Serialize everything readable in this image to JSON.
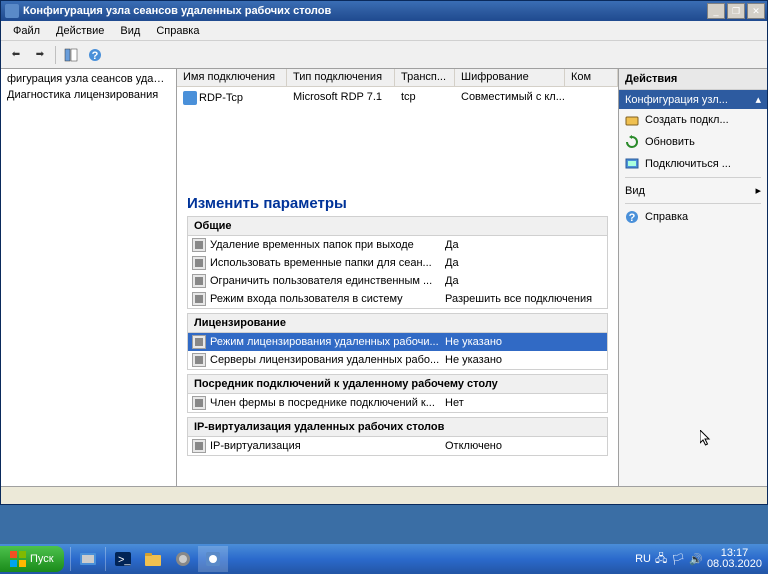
{
  "window": {
    "title": "Конфигурация узла сеансов удаленных рабочих столов"
  },
  "menu": {
    "file": "Файл",
    "action": "Действие",
    "view": "Вид",
    "help": "Справка"
  },
  "tree": {
    "item1": "фигурация узла сеансов удаленны",
    "item2": "Диагностика лицензирования"
  },
  "connections": {
    "headers": {
      "name": "Имя подключения",
      "type": "Тип подключения",
      "transport": "Трансп...",
      "encryption": "Шифрование",
      "com": "Ком"
    },
    "row": {
      "name": "RDP-Tcp",
      "type": "Microsoft RDP 7.1",
      "transport": "tcp",
      "encryption": "Совместимый с кл..."
    }
  },
  "settings": {
    "title": "Изменить параметры",
    "sections": {
      "general": {
        "header": "Общие",
        "items": [
          {
            "label": "Удаление временных папок при выходе",
            "value": "Да"
          },
          {
            "label": "Использовать временные папки для сеан...",
            "value": "Да"
          },
          {
            "label": "Ограничить пользователя единственным ...",
            "value": "Да"
          },
          {
            "label": "Режим входа пользователя в систему",
            "value": "Разрешить все подключения"
          }
        ]
      },
      "licensing": {
        "header": "Лицензирование",
        "items": [
          {
            "label": "Режим лицензирования удаленных рабочи...",
            "value": "Не указано"
          },
          {
            "label": "Серверы лицензирования удаленных рабо...",
            "value": "Не указано"
          }
        ]
      },
      "broker": {
        "header": "Посредник подключений к удаленному рабочему столу",
        "items": [
          {
            "label": "Член фермы в посреднике подключений к...",
            "value": "Нет"
          }
        ]
      },
      "ipvirt": {
        "header": "IP-виртуализация удаленных рабочих столов",
        "items": [
          {
            "label": "IP-виртуализация",
            "value": "Отключено"
          }
        ]
      }
    }
  },
  "actions": {
    "header": "Действия",
    "subheader": "Конфигурация узл...",
    "items": {
      "create": "Создать подкл...",
      "refresh": "Обновить",
      "connect": "Подключиться ...",
      "view": "Вид",
      "help": "Справка"
    }
  },
  "taskbar": {
    "start": "Пуск",
    "lang": "RU",
    "time": "13:17",
    "date": "08.03.2020"
  }
}
